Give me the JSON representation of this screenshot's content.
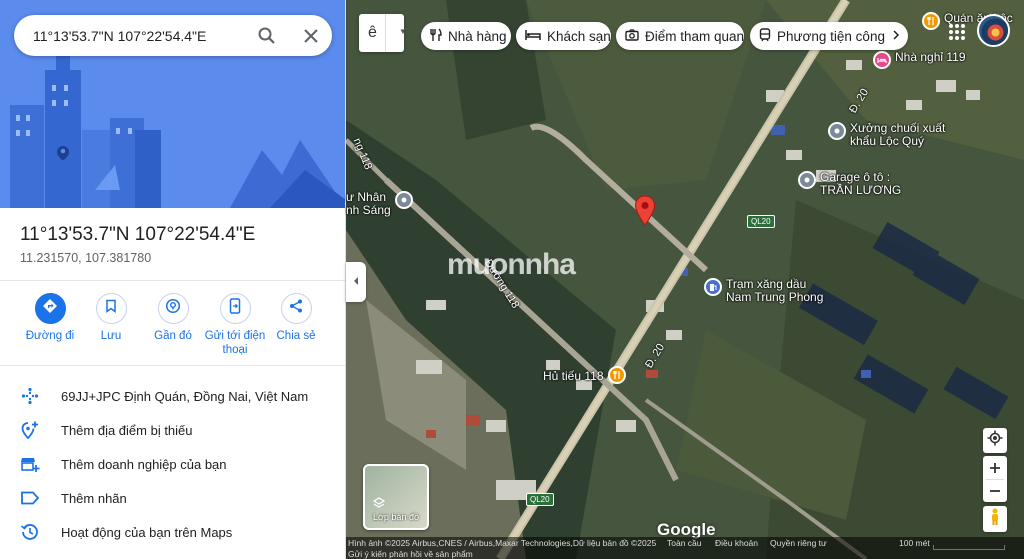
{
  "search": {
    "value": "11°13'53.7\"N 107°22'54.4\"E"
  },
  "place": {
    "title": "11°13'53.7\"N 107°22'54.4\"E",
    "coords": "11.231570, 107.381780"
  },
  "actions": [
    {
      "label": "Đường đi",
      "icon": "directions-icon"
    },
    {
      "label": "Lưu",
      "icon": "bookmark-icon"
    },
    {
      "label": "Gần đó",
      "icon": "nearby-icon"
    },
    {
      "label": "Gửi tới điện thoại",
      "icon": "send-to-phone-icon"
    },
    {
      "label": "Chia sẻ",
      "icon": "share-icon"
    }
  ],
  "list": [
    {
      "text": "69JJ+JPC Định Quán, Đồng Nai, Việt Nam",
      "icon": "plus-code-icon"
    },
    {
      "text": "Thêm địa điểm bị thiếu",
      "icon": "add-place-icon"
    },
    {
      "text": "Thêm doanh nghiệp của bạn",
      "icon": "add-business-icon"
    },
    {
      "text": "Thêm nhãn",
      "icon": "label-icon"
    },
    {
      "text": "Hoạt động của bạn trên Maps",
      "icon": "history-icon"
    }
  ],
  "map": {
    "lang_label": "ê",
    "chips": [
      {
        "label": "Nhà hàng",
        "icon": "restaurant-icon"
      },
      {
        "label": "Khách sạn",
        "icon": "hotel-icon"
      },
      {
        "label": "Điểm tham quan",
        "icon": "camera-icon"
      },
      {
        "label": "Phương tiện công c",
        "icon": "transit-icon"
      }
    ],
    "pois": [
      {
        "label": "Quán ăn Lộc",
        "color": "#f29900"
      },
      {
        "label": "Nhà nghỉ 119",
        "color": "#e8478b"
      },
      {
        "label": "Xưởng chuối xuất\nkhẩu Lộc Quý",
        "color": "#7a8a99"
      },
      {
        "label": "Garage ô tô :\nTRẦN LƯƠNG",
        "color": "#7a8a99"
      },
      {
        "label": "Trạm xăng dầu\nNam Trung Phong",
        "color": "#4a6fd0"
      },
      {
        "label": "Hủ tiếu 118",
        "color": "#f29900"
      },
      {
        "label": "ư Nhân\nnh Sáng",
        "color": "#7a8a99"
      }
    ],
    "road_labels": [
      "Đ. 20",
      "Đ. 20",
      "Đường 118",
      "ng 118"
    ],
    "highway_badges": [
      "QL20",
      "QL20"
    ],
    "watermark": "muonnha",
    "layers_label": "Lớp bản đồ",
    "google": "Google",
    "footer": {
      "imagery": "Hình ảnh ©2025 Airbus,CNES / Airbus,Maxar Technologies,Dữ liệu bản đồ ©2025",
      "terms": "Toàn cầu",
      "conditions": "Điều khoản",
      "privacy": "Quyền riêng tư",
      "feedback": "Gửi ý kiến phản hồi về sản phẩm",
      "scale": "100 mét"
    }
  },
  "colors": {
    "accent": "#1a73e8",
    "pin": "#ea4335"
  }
}
